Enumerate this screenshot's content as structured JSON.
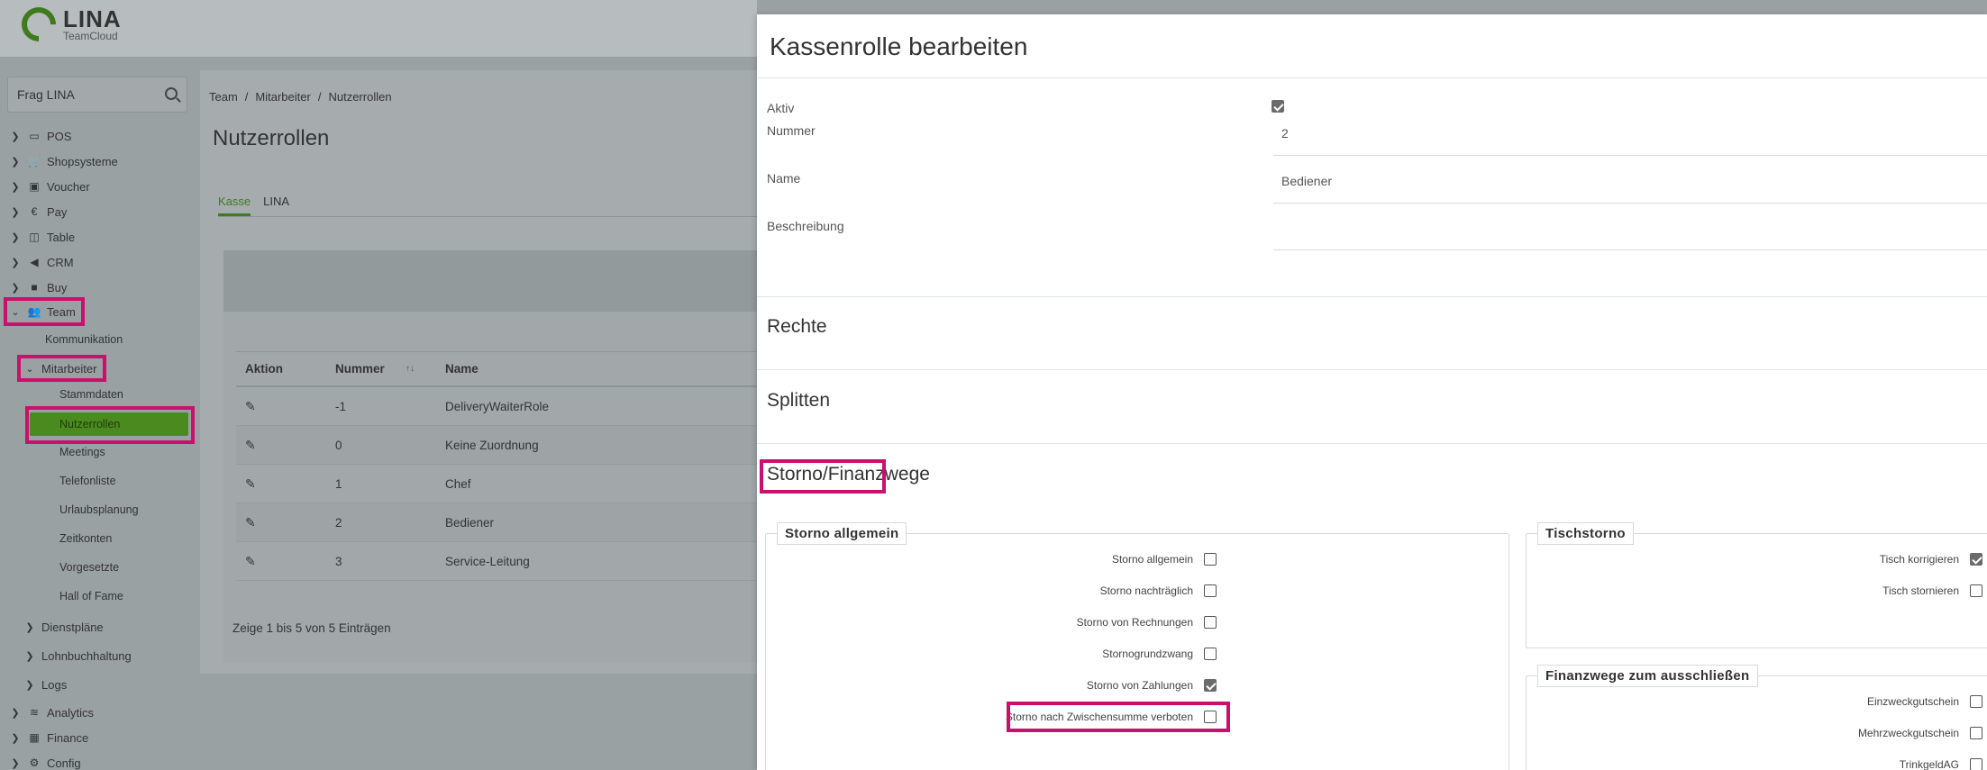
{
  "app": {
    "name": "LINA",
    "sub": "TeamCloud"
  },
  "search": {
    "placeholder": "Frag LINA"
  },
  "sidebar": {
    "top": [
      {
        "label": "POS",
        "icon": "monitor-icon"
      },
      {
        "label": "Shopsysteme",
        "icon": "cart-icon"
      },
      {
        "label": "Voucher",
        "icon": "gift-icon"
      },
      {
        "label": "Pay",
        "icon": "euro-icon"
      },
      {
        "label": "Table",
        "icon": "book-icon"
      },
      {
        "label": "CRM",
        "icon": "megaphone-icon"
      },
      {
        "label": "Buy",
        "icon": "truck-icon"
      },
      {
        "label": "Team",
        "icon": "users-icon"
      }
    ],
    "team_children": {
      "kommunikation": "Kommunikation",
      "mitarbeiter": "Mitarbeiter"
    },
    "mitarbeiter_children": [
      "Stammdaten",
      "Nutzerrollen",
      "Meetings",
      "Telefonliste",
      "Urlaubsplanung",
      "Zeitkonten",
      "Vorgesetzte",
      "Hall of Fame"
    ],
    "team_more": [
      "Dienstpläne",
      "Lohnbuchhaltung",
      "Logs"
    ],
    "bottom": [
      {
        "label": "Analytics",
        "icon": "chart-icon"
      },
      {
        "label": "Finance",
        "icon": "finance-icon"
      },
      {
        "label": "Config",
        "icon": "cogs-icon"
      }
    ]
  },
  "breadcrumb": [
    "Team",
    "/",
    "Mitarbeiter",
    "/",
    "Nutzerrollen"
  ],
  "page": {
    "title": "Nutzerrollen",
    "tabs": [
      "Kasse",
      "LINA"
    ]
  },
  "table": {
    "headers": {
      "action": "Aktion",
      "number": "Nummer",
      "name": "Name"
    },
    "sort_glyph": "↑↓",
    "rows": [
      {
        "number": "-1",
        "name": "DeliveryWaiterRole"
      },
      {
        "number": "0",
        "name": "Keine Zuordnung"
      },
      {
        "number": "1",
        "name": "Chef"
      },
      {
        "number": "2",
        "name": "Bediener"
      },
      {
        "number": "3",
        "name": "Service-Leitung"
      }
    ],
    "footer": "Zeige 1 bis 5 von 5 Einträgen"
  },
  "modal": {
    "title": "Kassenrolle bearbeiten",
    "fields": {
      "aktiv": {
        "label": "Aktiv",
        "checked": true
      },
      "nummer": {
        "label": "Nummer",
        "value": "2"
      },
      "name": {
        "label": "Name",
        "value": "Bediener"
      },
      "beschreibung": {
        "label": "Beschreibung",
        "value": ""
      }
    },
    "sections": {
      "rechte": "Rechte",
      "splitten": "Splitten",
      "storno": "Storno/Finanzwege"
    },
    "storno_allgemein": {
      "legend": "Storno allgemein",
      "options": [
        {
          "label": "Storno allgemein",
          "checked": false
        },
        {
          "label": "Storno nachträglich",
          "checked": false
        },
        {
          "label": "Storno von Rechnungen",
          "checked": false
        },
        {
          "label": "Stornogrundzwang",
          "checked": false
        },
        {
          "label": "Storno von Zahlungen",
          "checked": true
        },
        {
          "label": "Storno nach Zwischensumme verboten",
          "checked": false
        }
      ]
    },
    "tischstorno": {
      "legend": "Tischstorno",
      "options": [
        {
          "label": "Tisch korrigieren",
          "checked": true
        },
        {
          "label": "Tisch stornieren",
          "checked": false
        }
      ]
    },
    "finanzwege": {
      "legend": "Finanzwege zum ausschließen",
      "options": [
        {
          "label": "Einzweckgutschein",
          "checked": false
        },
        {
          "label": "Mehrzweckgutschein",
          "checked": false
        },
        {
          "label": "TrinkgeldAG",
          "checked": false
        }
      ]
    }
  },
  "colors": {
    "brand_green": "#3f7a1f",
    "highlight": "#c8106c"
  }
}
